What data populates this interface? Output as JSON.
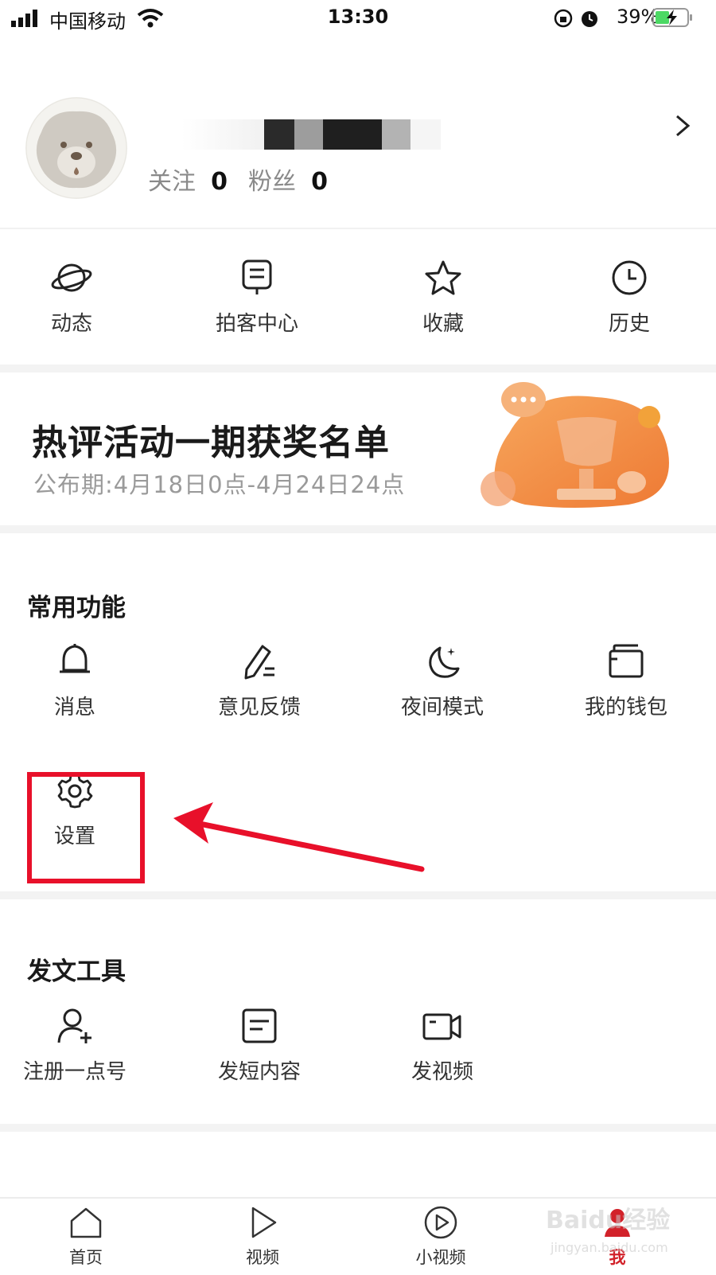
{
  "status_bar": {
    "carrier": "中国移动",
    "time": "13:30",
    "battery": "39%"
  },
  "profile": {
    "follow_label": "关注",
    "follow_count": "0",
    "fans_label": "粉丝",
    "fans_count": "0"
  },
  "quick_actions": [
    {
      "label": "动态",
      "icon": "planet-icon"
    },
    {
      "label": "拍客中心",
      "icon": "monitor-icon"
    },
    {
      "label": "收藏",
      "icon": "star-icon"
    },
    {
      "label": "历史",
      "icon": "clock-icon"
    }
  ],
  "banner": {
    "title": "热评活动一期获奖名单",
    "subtitle": "公布期:4月18日0点-4月24日24点"
  },
  "common": {
    "title": "常用功能",
    "items": [
      {
        "label": "消息",
        "icon": "bell-icon"
      },
      {
        "label": "意见反馈",
        "icon": "pencil-icon"
      },
      {
        "label": "夜间模式",
        "icon": "moon-icon"
      },
      {
        "label": "我的钱包",
        "icon": "wallet-icon"
      },
      {
        "label": "设置",
        "icon": "gear-icon"
      }
    ]
  },
  "publish": {
    "title": "发文工具",
    "items": [
      {
        "label": "注册一点号",
        "icon": "add-user-icon"
      },
      {
        "label": "发短内容",
        "icon": "document-icon"
      },
      {
        "label": "发视频",
        "icon": "video-camera-icon"
      }
    ]
  },
  "nav": {
    "items": [
      {
        "label": "首页",
        "icon": "home-icon"
      },
      {
        "label": "视频",
        "icon": "play-icon"
      },
      {
        "label": "小视频",
        "icon": "play-circle-icon"
      },
      {
        "label": "我",
        "icon": "profile-icon"
      }
    ]
  },
  "watermark": {
    "text": "Baidu经验",
    "url": "jingyan.baidu.com"
  },
  "colors": {
    "accent_red": "#d2222a",
    "highlight_box": "#e8102a",
    "banner_orange": "#f08a3c"
  }
}
